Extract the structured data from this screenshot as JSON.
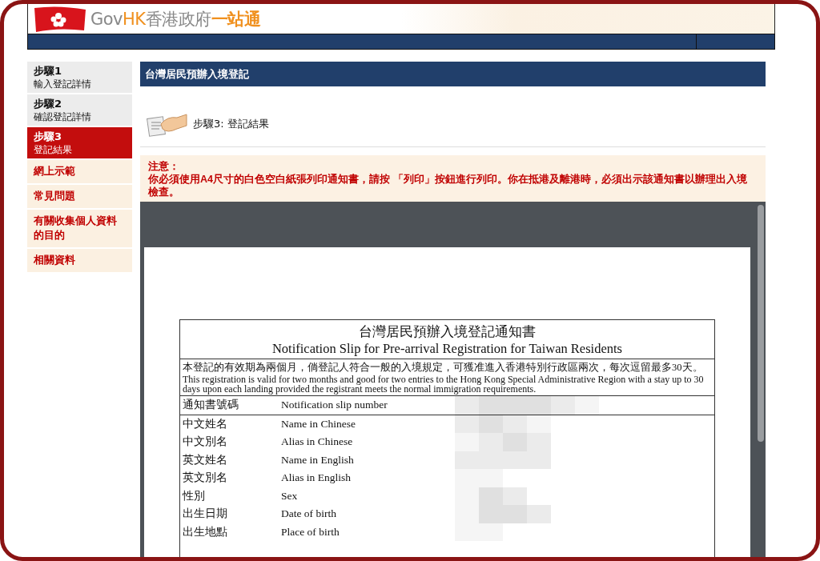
{
  "header": {
    "logo": {
      "gov": "Gov",
      "hk": "HK",
      "name": "香港政府",
      "tagline": "一站通"
    }
  },
  "sidebar": {
    "items": [
      {
        "kind": "step",
        "step": "步驟1",
        "label": "輸入登記詳情",
        "selected": false
      },
      {
        "kind": "step",
        "step": "步驟2",
        "label": "確認登記詳情",
        "selected": false
      },
      {
        "kind": "step",
        "step": "步驟3",
        "label": "登記結果",
        "selected": true
      },
      {
        "kind": "link",
        "label": "網上示範",
        "selected": false
      },
      {
        "kind": "link",
        "label": "常見問題",
        "selected": false
      },
      {
        "kind": "link",
        "label": "有關收集個人資料的目的",
        "selected": false
      },
      {
        "kind": "link",
        "label": "相關資料",
        "selected": false
      }
    ]
  },
  "main": {
    "title": "台灣居民預辦入境登記",
    "step_heading": "步驟3: 登記結果",
    "notice": {
      "title": "注意：",
      "text": "你必須使用**A4**尺寸的白色空白紙張列印通知書，請按 「列印」按鈕進行列印。你在抵港及離港時，必須出示該通知書以辦理出入境檢查。"
    },
    "document": {
      "title_zh": "台灣居民預辦入境登記通知書",
      "title_en": "Notification Slip for Pre-arrival Registration for Taiwan Residents",
      "validity_zh": "本登記的有效期為兩個月，倘登記人符合一般的入境規定，可獲准進入香港特別行政區兩次，每次逗留最多30天。",
      "validity_en": "This registration is valid for two months and good for two entries to the Hong Kong Special Administrative Region with a stay up to 30 days upon each landing provided the registrant meets the normal immigration requirements.",
      "fields": [
        {
          "zh": "通知書號碼",
          "en": "Notification slip number"
        },
        {
          "zh": "中文姓名",
          "en": "Name in Chinese"
        },
        {
          "zh": "中文別名",
          "en": "Alias in Chinese"
        },
        {
          "zh": "英文姓名",
          "en": "Name in English"
        },
        {
          "zh": "英文別名",
          "en": "Alias in English"
        },
        {
          "zh": "性別",
          "en": "Sex"
        },
        {
          "zh": "出生日期",
          "en": "Date of birth"
        },
        {
          "zh": "出生地點",
          "en": "Place of birth"
        }
      ]
    }
  }
}
